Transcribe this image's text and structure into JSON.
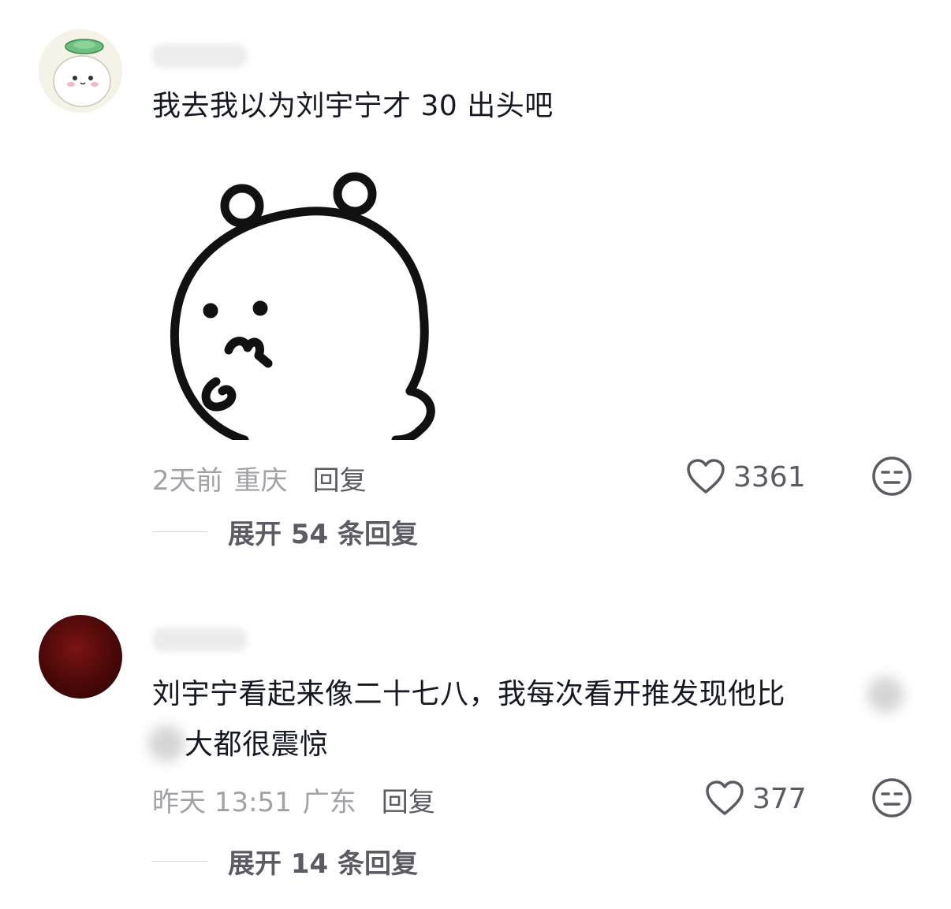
{
  "comments": [
    {
      "username": "",
      "text": "我去我以为刘宇宁才 30 出头吧",
      "sticker": "bear-thinking-sticker",
      "time": "2天前",
      "location": "重庆",
      "reply_label": "回复",
      "likes": "3361",
      "expand_label": "展开 54 条回复"
    },
    {
      "username": "",
      "text_line1": "刘宇宁看起来像二十七八，我每次看开推发现他比",
      "text_line2": "大都很震惊",
      "time": "昨天 13:51",
      "location": "广东",
      "reply_label": "回复",
      "likes": "377",
      "expand_label": "展开 14 条回复"
    }
  ],
  "icons": {
    "like": "heart-outline-icon",
    "dislike": "unamused-face-icon"
  },
  "colors": {
    "text": "#161823",
    "meta": "#a1a2a7",
    "action": "#5a5b63"
  }
}
